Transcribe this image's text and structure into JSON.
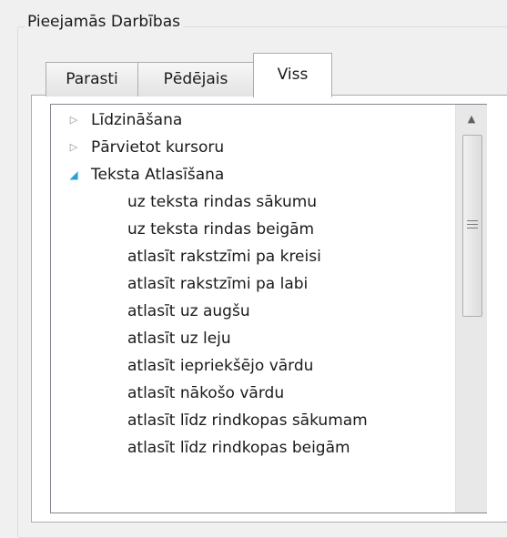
{
  "group_title": "Pieejamās Darbības",
  "tabs": [
    {
      "label": "Parasti",
      "selected": false
    },
    {
      "label": "Pēdējais",
      "selected": false
    },
    {
      "label": "Viss",
      "selected": true
    }
  ],
  "tree": {
    "categories": [
      {
        "label": "Līdzināšana",
        "expanded": false,
        "icon": "expand-triangle-icon"
      },
      {
        "label": "Pārvietot kursoru",
        "expanded": false,
        "icon": "expand-triangle-icon"
      },
      {
        "label": "Teksta Atlasīšana",
        "expanded": true,
        "icon": "collapse-triangle-icon"
      }
    ],
    "items": [
      "uz teksta rindas sākumu",
      "uz teksta rindas beigām",
      "atlasīt rakstzīmi pa kreisi",
      "atlasīt rakstzīmi pa labi",
      "atlasīt uz augšu",
      "atlasīt uz leju",
      "atlasīt iepriekšējo vārdu",
      "atlasīt nākošo vārdu",
      "atlasīt līdz rindkopas sākumam",
      "atlasīt līdz rindkopas beigām"
    ]
  },
  "scrollbar": {
    "up_icon": "scroll-up-arrow-icon",
    "grip_icon": "scroll-grip-icon"
  },
  "colors": {
    "expanded_arrow": "#26a0da",
    "collapsed_arrow": "#8c8c8c",
    "window_bg": "#f0f0f0"
  }
}
